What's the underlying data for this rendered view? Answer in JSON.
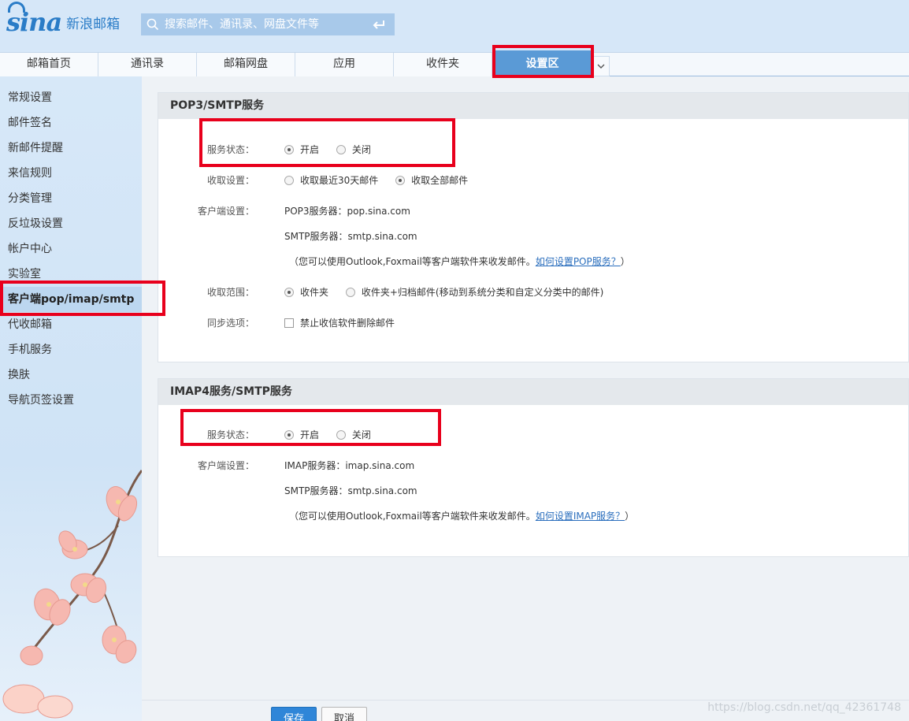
{
  "header": {
    "logo_mark": "sina",
    "logo_text": "新浪邮箱",
    "search_placeholder": "搜索邮件、通讯录、网盘文件等"
  },
  "nav": {
    "tabs": [
      {
        "label": "邮箱首页"
      },
      {
        "label": "通讯录"
      },
      {
        "label": "邮箱网盘"
      },
      {
        "label": "应用"
      },
      {
        "label": "收件夹"
      },
      {
        "label": "设置区",
        "active": true
      }
    ],
    "more_icon": "chevron-down-icon"
  },
  "sidebar": {
    "items": [
      {
        "label": "常规设置"
      },
      {
        "label": "邮件签名"
      },
      {
        "label": "新邮件提醒"
      },
      {
        "label": "来信规则"
      },
      {
        "label": "分类管理"
      },
      {
        "label": "反垃圾设置"
      },
      {
        "label": "帐户中心"
      },
      {
        "label": "实验室"
      },
      {
        "label": "客户端pop/imap/smtp",
        "active": true
      },
      {
        "label": "代收邮箱"
      },
      {
        "label": "手机服务"
      },
      {
        "label": "换肤"
      },
      {
        "label": "导航页签设置"
      }
    ]
  },
  "pop3": {
    "title": "POP3/SMTP服务",
    "status_label": "服务状态：",
    "status_on": "开启",
    "status_off": "关闭",
    "fetch_label": "收取设置：",
    "fetch_recent": "收取最近30天邮件",
    "fetch_all": "收取全部邮件",
    "client_label": "客户端设置：",
    "server_pop": "POP3服务器：pop.sina.com",
    "server_smtp": "SMTP服务器：smtp.sina.com",
    "note": "（您可以使用Outlook,Foxmail等客户端软件来收发邮件。",
    "note_link": "如何设置POP服务？",
    "note_end": "）",
    "range_label": "收取范围：",
    "range_inbox": "收件夹",
    "range_archive": "收件夹+归档邮件(移动到系统分类和自定义分类中的邮件)",
    "sync_label": "同步选项：",
    "sync_option": "禁止收信软件删除邮件"
  },
  "imap": {
    "title": "IMAP4服务/SMTP服务",
    "status_label": "服务状态：",
    "status_on": "开启",
    "status_off": "关闭",
    "client_label": "客户端设置：",
    "server_imap": "IMAP服务器：imap.sina.com",
    "server_smtp": "SMTP服务器：smtp.sina.com",
    "note": "（您可以使用Outlook,Foxmail等客户端软件来收发邮件。",
    "note_link": "如何设置IMAP服务？",
    "note_end": "）"
  },
  "footer": {
    "save": "保存",
    "cancel": "取消",
    "watermark": "https://blog.csdn.net/qq_42361748"
  },
  "colors": {
    "accent": "#5a9ad6",
    "highlight": "#e8001c",
    "link": "#2a6ebd"
  }
}
